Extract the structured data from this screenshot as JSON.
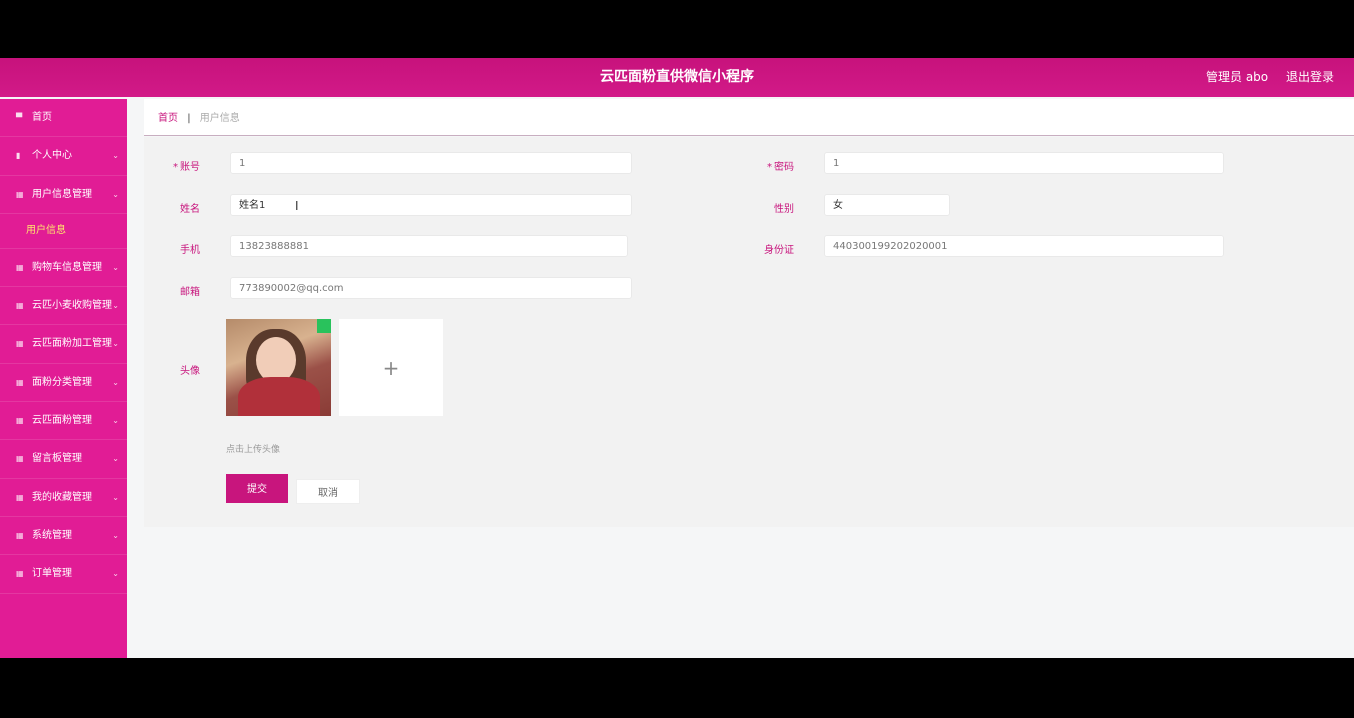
{
  "app": {
    "title": "云匹面粉直供微信小程序",
    "user_label": "管理员 abo",
    "logout_label": "退出登录",
    "accent_color": "#c8157d",
    "sidebar_color": "#e11c95"
  },
  "sidebar": {
    "items": [
      {
        "label": "首页",
        "icon": "home-icon",
        "has_arrow": false
      },
      {
        "label": "个人中心",
        "icon": "person-icon",
        "has_arrow": true
      },
      {
        "label": "用户信息管理",
        "icon": "grid-icon",
        "has_arrow": true
      },
      {
        "label": "用户信息",
        "sub": true
      },
      {
        "label": "购物车信息管理",
        "icon": "grid-icon",
        "has_arrow": true
      },
      {
        "label": "云匹小麦收购管理",
        "icon": "grid-icon",
        "has_arrow": true
      },
      {
        "label": "云匹面粉加工管理",
        "icon": "grid-icon",
        "has_arrow": true
      },
      {
        "label": "面粉分类管理",
        "icon": "grid-icon",
        "has_arrow": true
      },
      {
        "label": "云匹面粉管理",
        "icon": "grid-icon",
        "has_arrow": true
      },
      {
        "label": "留言板管理",
        "icon": "grid-icon",
        "has_arrow": true
      },
      {
        "label": "我的收藏管理",
        "icon": "grid-icon",
        "has_arrow": true
      },
      {
        "label": "系统管理",
        "icon": "grid-icon",
        "has_arrow": true
      },
      {
        "label": "订单管理",
        "icon": "grid-icon",
        "has_arrow": true
      }
    ]
  },
  "breadcrumb": {
    "home": "首页",
    "separator": "|",
    "current": "用户信息"
  },
  "form": {
    "account_label": "账号",
    "account_value": "1",
    "password_label": "密码",
    "password_value": "1",
    "name_label": "姓名",
    "name_value": "姓名1",
    "gender_label": "性别",
    "gender_value": "女",
    "phone_label": "手机",
    "phone_value": "13823888881",
    "idcard_label": "身份证",
    "idcard_value": "440300199202020001",
    "email_label": "邮箱",
    "email_value": "773890002@qq.com",
    "avatar_label": "头像",
    "upload_plus": "+",
    "hint": "点击上传头像",
    "submit_label": "提交",
    "cancel_label": "取消"
  }
}
